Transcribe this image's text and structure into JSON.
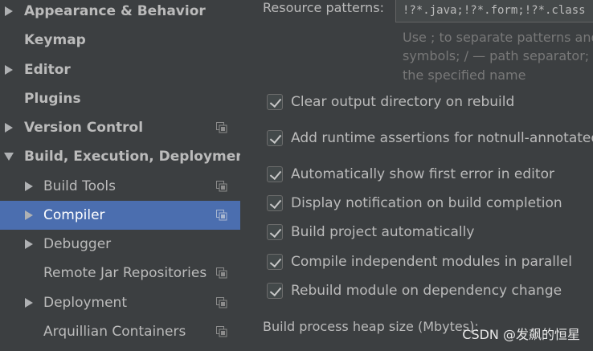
{
  "sidebar": {
    "items": [
      {
        "label": "Appearance & Behavior",
        "arrow": "right",
        "bold": true,
        "scope": false
      },
      {
        "label": "Keymap",
        "arrow": "none",
        "bold": true,
        "scope": false
      },
      {
        "label": "Editor",
        "arrow": "right",
        "bold": true,
        "scope": false
      },
      {
        "label": "Plugins",
        "arrow": "none",
        "bold": true,
        "scope": false
      },
      {
        "label": "Version Control",
        "arrow": "right",
        "bold": true,
        "scope": true
      },
      {
        "label": "Build, Execution, Deployment",
        "arrow": "down",
        "bold": true,
        "scope": false
      },
      {
        "label": "Build Tools",
        "arrow": "right",
        "bold": false,
        "scope": true
      },
      {
        "label": "Compiler",
        "arrow": "right",
        "bold": false,
        "scope": true,
        "selected": true
      },
      {
        "label": "Debugger",
        "arrow": "right",
        "bold": false,
        "scope": false
      },
      {
        "label": "Remote Jar Repositories",
        "arrow": "none",
        "bold": false,
        "scope": true
      },
      {
        "label": "Deployment",
        "arrow": "right",
        "bold": false,
        "scope": true
      },
      {
        "label": "Arquillian Containers",
        "arrow": "none",
        "bold": false,
        "scope": true
      }
    ]
  },
  "content": {
    "resource_patterns_label": "Resource patterns:",
    "resource_patterns_value": "!?*.java;!?*.form;!?*.class",
    "hint_lines": [
      "Use ; to separate patterns and",
      "symbols; / — path separator;",
      "the specified name"
    ],
    "checkboxes": [
      {
        "label": "Clear output directory on rebuild",
        "checked": true
      },
      {
        "label": "Add runtime assertions for notnull-annotated m",
        "checked": true
      },
      {
        "label": "Automatically show first error in editor",
        "checked": true
      },
      {
        "label": "Display notification on build completion",
        "checked": true
      },
      {
        "label": "Build project automatically",
        "checked": true
      },
      {
        "label": "Compile independent modules in parallel",
        "checked": true
      },
      {
        "label": "Rebuild module on dependency change",
        "checked": true
      }
    ],
    "heap_label": "Build process heap size (Mbytes):"
  },
  "watermark": "CSDN @发飙的恒星",
  "colors": {
    "background": "#3c3f41",
    "selection": "#4b6eaf",
    "text": "#bbbbbb",
    "hint": "#787878"
  }
}
